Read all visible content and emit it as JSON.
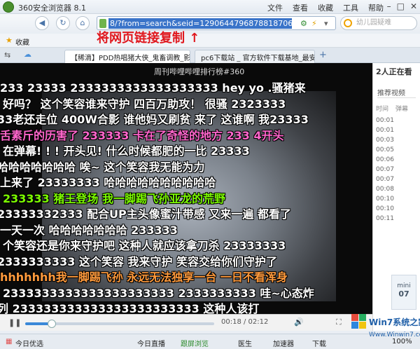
{
  "window": {
    "title": "360安全浏览器 8.1",
    "menus": [
      "文件",
      "查看",
      "收藏",
      "工具",
      "帮助"
    ]
  },
  "toolbar": {
    "address_selected": "8/?from=search&seid=12906447968788187068",
    "search_placeholder": "幼儿园疑难"
  },
  "favorites": {
    "label": "收藏"
  },
  "annotation": {
    "text": "将网页链接复制 ↑"
  },
  "tabs": [
    {
      "label": "【稀滴】PDD热唱猪大侠_鬼畜调教_影视"
    },
    {
      "label": "pc6下载站 _ 官方软件下载基地_最安全"
    }
  ],
  "video": {
    "title": "周刊哔哩哔哩排行榜#360",
    "time": "00:18 / 02:12",
    "progress": 0.14,
    "danmaku": [
      "233  23333  2333333333333333333  hey yo .骚猪来",
      "好吗？    这个笑容谁来守护     四百万助攻！  很骚     2323333",
      "33老还走位    400W合影 谁他妈又刷贫 来了  这谁啊  我23333",
      "舌素斤的历害了    233333 卡在了奇怪的地方   233    4开头",
      "在弹幕! ! !   开头见!    什么时候都肥的一比 23333",
      "哈哈哈哈哈哈哈    唉~    这个笑容我无能为力",
      "上来了           23333333      哈哈哈哈哈哈哈哈哈哈",
      "233333             猪王登场   我一脚踢飞孙亚龙的荒野",
      "23333332333    配合UP主头像蜜汁带感  又来一遍 都看了",
      "一天一次       哈哈哈哈哈哈哈         233333",
      "个笑容还是你来守护吧    这种人就应该拿刀杀  23333333",
      "2333333333 这个笑容 我来守护 笑容交给你们守护了",
      "hhhhhhh我一脚踢飞孙  永远无法独享一台   一日不看浑身",
      "2333333333333333333333   2333333333    哇~心态炸",
      "列          233333333333333333333333     这种人该打"
    ]
  },
  "sidebar": {
    "header": "2人正在看",
    "tab": "推荐视频",
    "cols": [
      "时间",
      "弹幕"
    ],
    "rows": [
      "00:01",
      "00:01",
      "00:03",
      "00:05",
      "00:06",
      "00:07",
      "00:07",
      "00:08",
      "00:10",
      "00:10",
      "00:11"
    ],
    "widget_label": "mini",
    "widget_num": "07"
  },
  "status": {
    "left": "今日优选",
    "items": [
      "今日直播",
      "跟屏浏览",
      "医生",
      "加速器",
      "下载"
    ],
    "zoom": "100%"
  },
  "watermark": {
    "line1": "Win7系统之家",
    "line2": "Www.Winwin7.com"
  }
}
